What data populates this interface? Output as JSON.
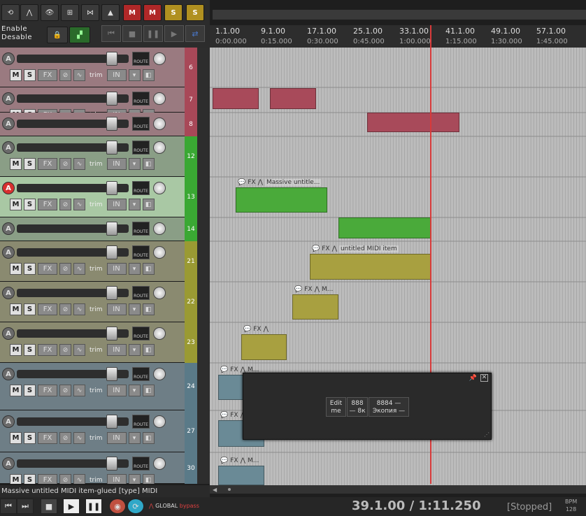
{
  "toolbar": {
    "enable_text": "Enable",
    "desable_text": "Desable",
    "buttons": [
      "M",
      "M",
      "S",
      "S"
    ]
  },
  "ruler": {
    "measures": [
      "1.1.00",
      "9.1.00",
      "17.1.00",
      "25.1.00",
      "33.1.00",
      "41.1.00",
      "49.1.00",
      "57.1.00"
    ],
    "times": [
      "0:00.000",
      "0:15.000",
      "0:30.000",
      "0:45.000",
      "1:00.000",
      "1:15.000",
      "1:30.000",
      "1:45.000"
    ]
  },
  "tracks": [
    {
      "num": "6",
      "color": "#a84858",
      "bg": "#9a7a80"
    },
    {
      "num": "7",
      "color": "#a84858",
      "bg": "#9a7a80"
    },
    {
      "num": "8",
      "color": "#a84858",
      "bg": "#9a7a80"
    },
    {
      "num": "12",
      "color": "#3aa833",
      "bg": "#8a9e86"
    },
    {
      "num": "13",
      "color": "#3aa833",
      "bg": "#a9c8a4",
      "armed": true
    },
    {
      "num": "14",
      "color": "#3aa833",
      "bg": "#8a9e86"
    },
    {
      "num": "21",
      "color": "#9a9a33",
      "bg": "#8a8a70"
    },
    {
      "num": "22",
      "color": "#9a9a33",
      "bg": "#8a8a70"
    },
    {
      "num": "23",
      "color": "#9a9a33",
      "bg": "#8a8a70"
    },
    {
      "num": "24",
      "color": "#5a7a88",
      "bg": "#6e7e86"
    },
    {
      "num": "27",
      "color": "#5a7a88",
      "bg": "#6e7e86"
    },
    {
      "num": "30",
      "color": "#5a7a88",
      "bg": "#6e7e86"
    }
  ],
  "labels": {
    "m": "M",
    "s": "S",
    "fx": "FX",
    "trim": "trim",
    "in": "IN",
    "route": "ROUTE",
    "arm": "A"
  },
  "items": {
    "massive": "Massive untitle...",
    "untitled": "untitled MIDI item",
    "m": "M...",
    "fx": "FX"
  },
  "float": {
    "cell1": "Edit me",
    "cell2": "888 — 8к",
    "cell3": "8884 — Экопия —"
  },
  "status": "Massive untitled MIDI item-glued [type] MIDI",
  "transport": {
    "time": "39.1.00 / 1:11.250",
    "state": "[Stopped]",
    "bpm_label": "BPM",
    "bpm": "128",
    "global": "GLOBAL",
    "bypass": "bypass"
  }
}
